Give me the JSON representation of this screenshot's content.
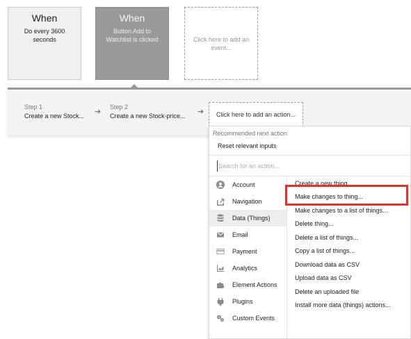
{
  "events": [
    {
      "title": "When",
      "desc": "Do every 3600 seconds"
    },
    {
      "title": "When",
      "desc": "Button Add to Watchlist is clicked"
    },
    {
      "desc": "Click here to add an event..."
    }
  ],
  "steps": [
    {
      "label": "Step 1",
      "text": "Create a new Stock..."
    },
    {
      "label": "Step 2",
      "text": "Create a new Stock-price..."
    }
  ],
  "arrow_glyph": "➔",
  "add_action": "Click here to add an action...",
  "dropdown": {
    "recommended_label": "Recommended next action",
    "reset_link": "Reset relevant inputs",
    "search_placeholder": "Search for an action...",
    "categories": [
      {
        "label": "Account",
        "icon": "account-icon"
      },
      {
        "label": "Navigation",
        "icon": "navigation-icon"
      },
      {
        "label": "Data (Things)",
        "icon": "database-icon"
      },
      {
        "label": "Email",
        "icon": "email-icon"
      },
      {
        "label": "Payment",
        "icon": "payment-icon"
      },
      {
        "label": "Analytics",
        "icon": "analytics-icon"
      },
      {
        "label": "Element Actions",
        "icon": "puzzle-icon"
      },
      {
        "label": "Plugins",
        "icon": "plug-icon"
      },
      {
        "label": "Custom Events",
        "icon": "gears-icon"
      }
    ],
    "active_category": "Data (Things)",
    "actions": [
      "Create a new thing...",
      "Make changes to thing...",
      "Make changes to a list of things...",
      "Delete thing...",
      "Delete a list of things...",
      "Copy a list of things...",
      "Download data as CSV",
      "Upload data as CSV",
      "Delete an uploaded file",
      "Install more data (things) actions..."
    ],
    "highlighted_action": "Make changes to thing..."
  },
  "colors": {
    "highlight": "#e0332b",
    "event_active": "#9a9a9a",
    "event_inactive": "#eff1ef"
  }
}
